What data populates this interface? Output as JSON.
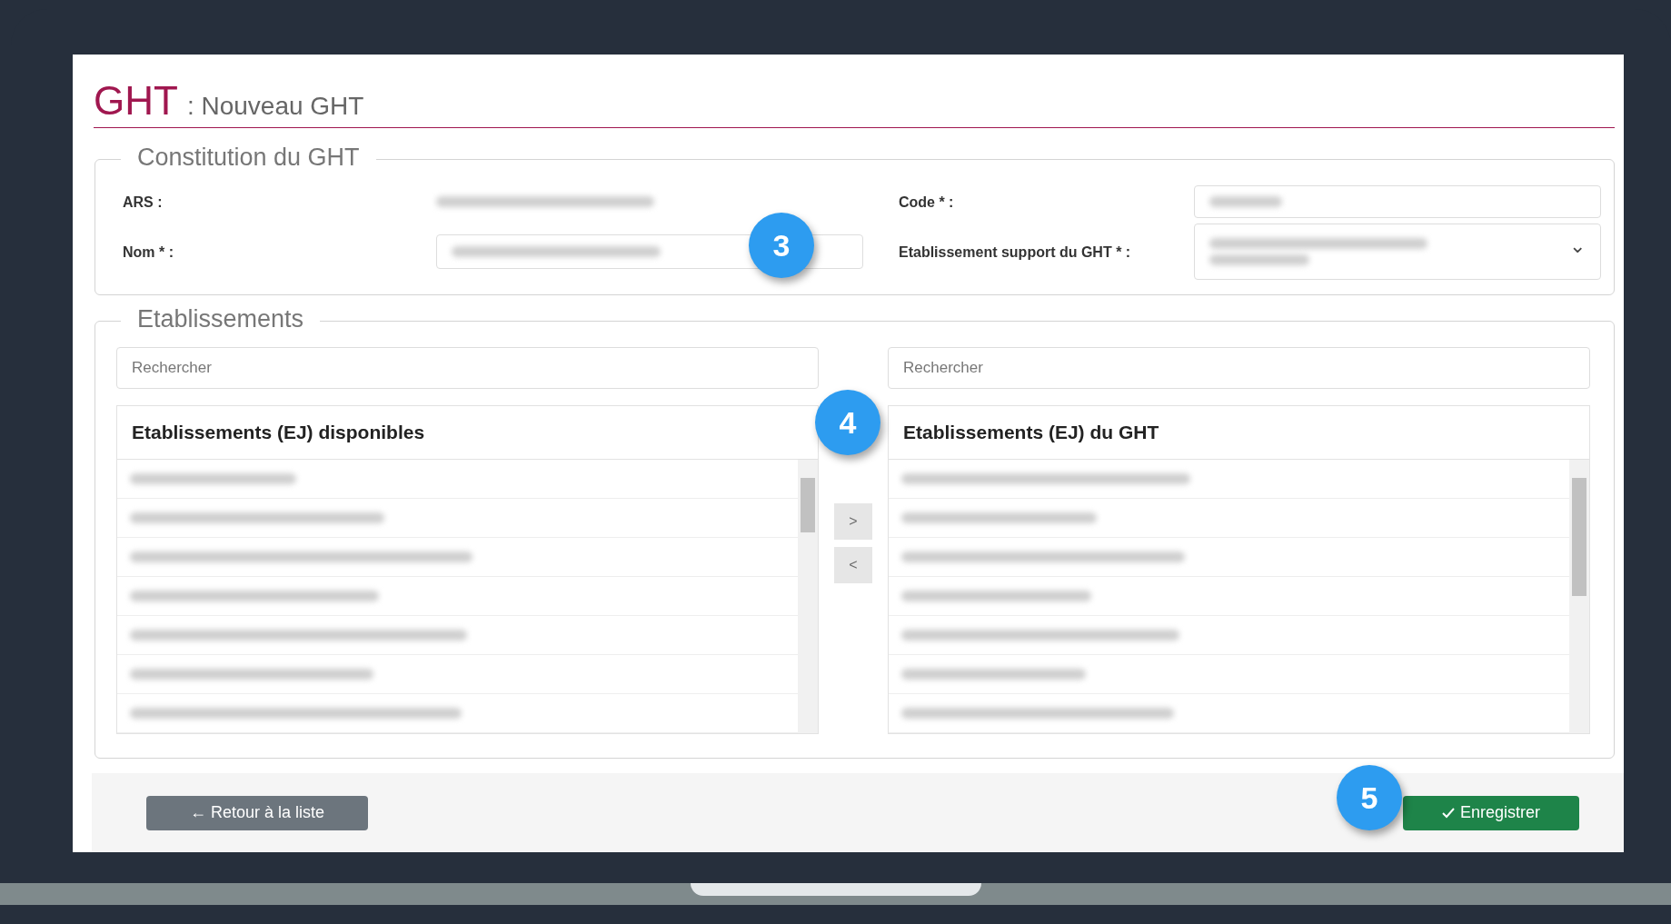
{
  "header": {
    "title": "GHT",
    "subtitle": ": Nouveau GHT"
  },
  "constitution": {
    "legend": "Constitution du GHT",
    "ars": {
      "label": "ARS :"
    },
    "nom": {
      "label": "Nom * :"
    },
    "code": {
      "label": "Code * :"
    },
    "support": {
      "label": "Etablissement support du GHT * :",
      "chevron": "⌄"
    }
  },
  "etablissements": {
    "legend": "Etablissements",
    "available": {
      "search_placeholder": "Rechercher",
      "heading": "Etablissements (EJ) disponibles",
      "rows": [
        {
          "kind": "blurred"
        },
        {
          "kind": "blurred"
        },
        {
          "kind": "blurred"
        },
        {
          "kind": "blurred"
        },
        {
          "kind": "blurred"
        },
        {
          "kind": "blurred"
        },
        {
          "kind": "blurred"
        }
      ]
    },
    "selected_list": {
      "search_placeholder": "Rechercher",
      "heading": "Etablissements (EJ) du GHT",
      "rows": [
        {
          "kind": "blurred"
        },
        {
          "kind": "blurred"
        },
        {
          "kind": "blurred"
        },
        {
          "kind": "blurred"
        },
        {
          "kind": "blurred"
        },
        {
          "kind": "blurred"
        },
        {
          "kind": "blurred"
        }
      ]
    },
    "move_buttons": [
      {
        "label": ">",
        "disabled": true
      },
      {
        "label": "<",
        "disabled": true
      }
    ]
  },
  "footer": {
    "back_button": "← Retour à la liste",
    "save_button": "Enregistrer"
  },
  "callouts": [
    {
      "label": "3"
    },
    {
      "label": "4"
    },
    {
      "label": "5"
    }
  ]
}
